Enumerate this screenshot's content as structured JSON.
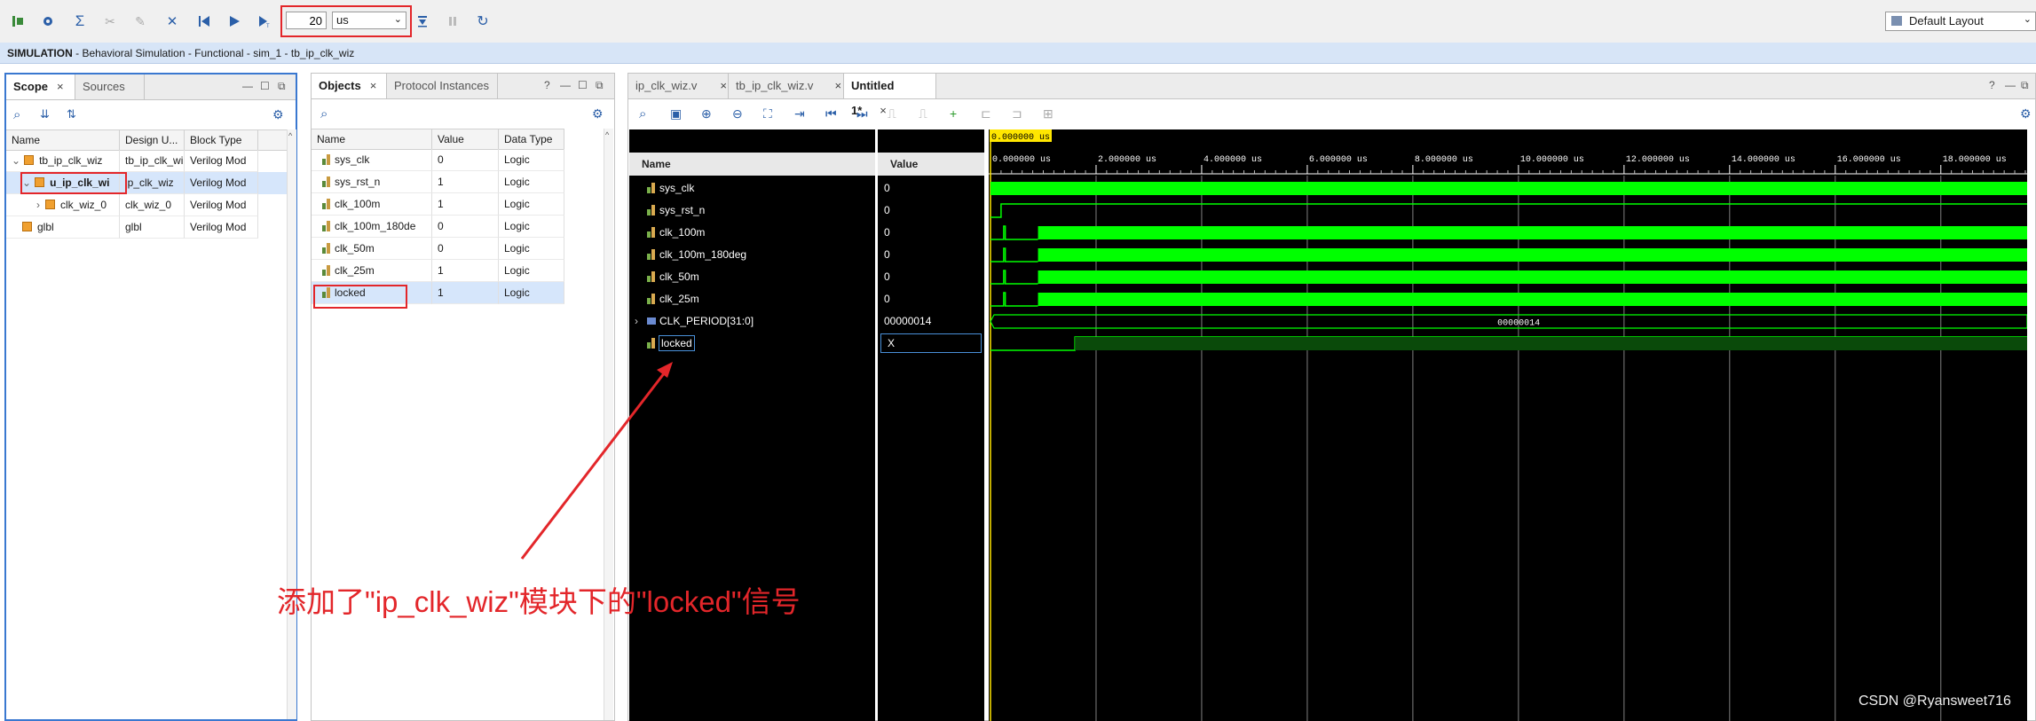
{
  "toolbar": {
    "run_time_value": "20",
    "run_time_unit": "us",
    "layout": "Default Layout",
    "icons": [
      "restart-icon",
      "settings-icon",
      "sigma-icon",
      "break-icon",
      "step-icon",
      "relaunch-icon",
      "skip-back-icon",
      "run-icon",
      "run-for-icon",
      "run-step-icon",
      "pause-icon",
      "refresh-icon"
    ]
  },
  "banner": {
    "label": "SIMULATION",
    "path": " - Behavioral Simulation - Functional - sim_1 - tb_ip_clk_wiz"
  },
  "scope_panel": {
    "tabs": [
      "Scope",
      "Sources"
    ],
    "columns": [
      "Name",
      "Design U...",
      "Block Type"
    ],
    "rows": [
      {
        "name": "tb_ip_clk_wiz",
        "design": "tb_ip_clk_wi",
        "type": "Verilog Mod"
      },
      {
        "name": "u_ip_clk_wi",
        "design": "ip_clk_wiz",
        "type": "Verilog Mod"
      },
      {
        "name": "clk_wiz_0",
        "design": "clk_wiz_0",
        "type": "Verilog Mod"
      },
      {
        "name": "glbl",
        "design": "glbl",
        "type": "Verilog Mod"
      }
    ]
  },
  "objects_panel": {
    "tabs": [
      "Objects",
      "Protocol Instances"
    ],
    "columns": [
      "Name",
      "Value",
      "Data Type"
    ],
    "rows": [
      {
        "name": "sys_clk",
        "value": "0",
        "type": "Logic"
      },
      {
        "name": "sys_rst_n",
        "value": "1",
        "type": "Logic"
      },
      {
        "name": "clk_100m",
        "value": "1",
        "type": "Logic"
      },
      {
        "name": "clk_100m_180de",
        "value": "0",
        "type": "Logic"
      },
      {
        "name": "clk_50m",
        "value": "0",
        "type": "Logic"
      },
      {
        "name": "clk_25m",
        "value": "1",
        "type": "Logic"
      },
      {
        "name": "locked",
        "value": "1",
        "type": "Logic"
      }
    ]
  },
  "wave_panel": {
    "tabs": [
      "ip_clk_wiz.v",
      "tb_ip_clk_wiz.v",
      "Untitled 1*"
    ],
    "name_header": "Name",
    "value_header": "Value",
    "cursor_label": "0.000000 us",
    "signals": [
      {
        "name": "sys_clk",
        "value": "0"
      },
      {
        "name": "sys_rst_n",
        "value": "0"
      },
      {
        "name": "clk_100m",
        "value": "0"
      },
      {
        "name": "clk_100m_180deg",
        "value": "0"
      },
      {
        "name": "clk_50m",
        "value": "0"
      },
      {
        "name": "clk_25m",
        "value": "0"
      },
      {
        "name": "CLK_PERIOD[31:0]",
        "value": "00000014"
      },
      {
        "name": "locked",
        "value": "X"
      }
    ],
    "bus_label": "00000014",
    "time_axis": {
      "unit": "us",
      "ticks": [
        "0.000000 us",
        "2.000000 us",
        "4.000000 us",
        "6.000000 us",
        "8.000000 us",
        "10.000000 us",
        "12.000000 us",
        "14.000000 us",
        "16.000000 us",
        "18.000000 us"
      ],
      "range": [
        0,
        19.5
      ]
    },
    "colors": {
      "wave": "#00ff00",
      "background": "#000000",
      "grid": "#808080"
    }
  },
  "annotation": "添加了\"ip_clk_wiz\"模块下的\"locked\"信号",
  "watermark": "CSDN @Ryansweet716"
}
